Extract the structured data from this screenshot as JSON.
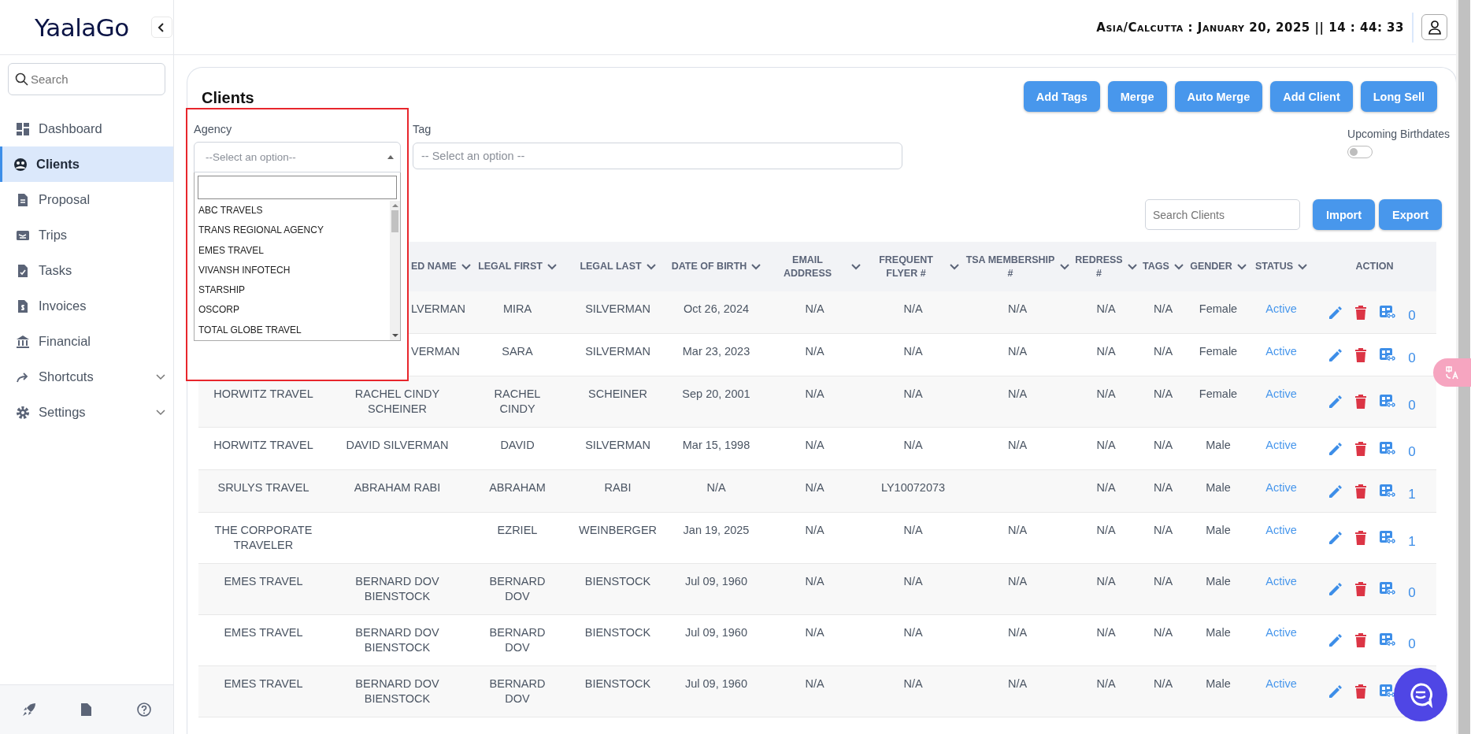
{
  "app": {
    "logo": "YaalaGo",
    "clock": "Asia/Calcutta : January 20, 2025 || 14 : 44: 33"
  },
  "sidebar": {
    "search": {
      "placeholder": "Search"
    },
    "items": [
      {
        "label": "Dashboard",
        "kind": "link",
        "selected": false
      },
      {
        "label": "Clients",
        "kind": "link",
        "selected": true
      },
      {
        "label": "Proposal",
        "kind": "link",
        "selected": false
      },
      {
        "label": "Trips",
        "kind": "link",
        "selected": false
      },
      {
        "label": "Tasks",
        "kind": "link",
        "selected": false
      },
      {
        "label": "Invoices",
        "kind": "link",
        "selected": false
      },
      {
        "label": "Financial",
        "kind": "link",
        "selected": false
      },
      {
        "label": "Shortcuts",
        "kind": "group",
        "selected": false
      },
      {
        "label": "Settings",
        "kind": "group",
        "selected": false
      }
    ]
  },
  "page": {
    "title": "Clients",
    "buttons": [
      "Add Tags",
      "Merge",
      "Auto Merge",
      "Add Client",
      "Long Sell"
    ],
    "agency": {
      "label": "Agency",
      "placeholder": "--Select an option--",
      "expanded": true,
      "options": [
        "ABC TRAVELS",
        "TRANS REGIONAL AGENCY",
        "EMES TRAVEL",
        "VIVANSH INFOTECH",
        "STARSHIP",
        "OSCORP",
        "TOTAL GLOBE TRAVEL"
      ]
    },
    "tag": {
      "label": "Tag",
      "placeholder": "-- Select an option --"
    },
    "birthdates": {
      "label": "Upcoming Birthdates",
      "on": false
    },
    "search": {
      "placeholder": "Search Clients"
    },
    "table_buttons": [
      "Import",
      "Export"
    ]
  },
  "table": {
    "columns": [
      {
        "label": "ED NAME",
        "sortable": true
      },
      {
        "label": "LEGAL FIRST",
        "sortable": true
      },
      {
        "label": "LEGAL LAST",
        "sortable": true
      },
      {
        "label": "DATE OF BIRTH",
        "sortable": true
      },
      {
        "label": "EMAIL ADDRESS",
        "sortable": true
      },
      {
        "label": "FREQUENT FLYER #",
        "sortable": true
      },
      {
        "label": "TSA MEMBERSHIP #",
        "sortable": true
      },
      {
        "label": "REDRESS #",
        "sortable": true
      },
      {
        "label": "TAGS",
        "sortable": true
      },
      {
        "label": "GENDER",
        "sortable": true
      },
      {
        "label": "STATUS",
        "sortable": true
      },
      {
        "label": "ACTION",
        "sortable": false
      }
    ],
    "rows": [
      {
        "cells": [
          "LVERMAN",
          "MIRA",
          "SILVERMAN",
          "Oct 26, 2024",
          "N/A",
          "N/A",
          "N/A",
          "N/A",
          "N/A",
          "Female"
        ],
        "status": "Active",
        "count": "0"
      },
      {
        "cells": [
          "VERMAN",
          "SARA",
          "SILVERMAN",
          "Mar 23, 2023",
          "N/A",
          "N/A",
          "N/A",
          "N/A",
          "N/A",
          "Female"
        ],
        "status": "Active",
        "count": "0"
      },
      {
        "agency": "HORWITZ TRAVEL",
        "cells": [
          "RACHEL CINDY SCHEINER",
          "RACHEL CINDY",
          "SCHEINER",
          "Sep 20, 2001",
          "N/A",
          "N/A",
          "N/A",
          "N/A",
          "N/A",
          "Female"
        ],
        "status": "Active",
        "count": "0"
      },
      {
        "agency": "HORWITZ TRAVEL",
        "cells": [
          "DAVID SILVERMAN",
          "DAVID",
          "SILVERMAN",
          "Mar 15, 1998",
          "N/A",
          "N/A",
          "N/A",
          "N/A",
          "N/A",
          "Male"
        ],
        "status": "Active",
        "count": "0"
      },
      {
        "agency": "SRULYS TRAVEL",
        "cells": [
          "ABRAHAM RABI",
          "ABRAHAM",
          "RABI",
          "N/A",
          "N/A",
          "LY10072073",
          null,
          "N/A",
          "N/A",
          "Male"
        ],
        "status": "Active",
        "count": "1"
      },
      {
        "agency": "THE CORPORATE TRAVELER",
        "cells": [
          null,
          "EZRIEL",
          "WEINBERGER",
          "Jan 19, 2025",
          "N/A",
          "N/A",
          "N/A",
          "N/A",
          "N/A",
          "Male"
        ],
        "status": "Active",
        "count": "1"
      },
      {
        "agency": "EMES TRAVEL",
        "cells": [
          "BERNARD DOV BIENSTOCK",
          "BERNARD DOV",
          "BIENSTOCK",
          "Jul 09, 1960",
          "N/A",
          "N/A",
          "N/A",
          "N/A",
          "N/A",
          "Male"
        ],
        "status": "Active",
        "count": "0"
      },
      {
        "agency": "EMES TRAVEL",
        "cells": [
          "BERNARD DOV BIENSTOCK",
          "BERNARD DOV",
          "BIENSTOCK",
          "Jul 09, 1960",
          "N/A",
          "N/A",
          "N/A",
          "N/A",
          "N/A",
          "Male"
        ],
        "status": "Active",
        "count": "0"
      },
      {
        "agency": "EMES TRAVEL",
        "cells": [
          "BERNARD DOV BIENSTOCK",
          "BERNARD DOV",
          "BIENSTOCK",
          "Jul 09, 1960",
          "N/A",
          "N/A",
          "N/A",
          "N/A",
          "N/A",
          "Male"
        ],
        "status": "Active"
      }
    ]
  }
}
